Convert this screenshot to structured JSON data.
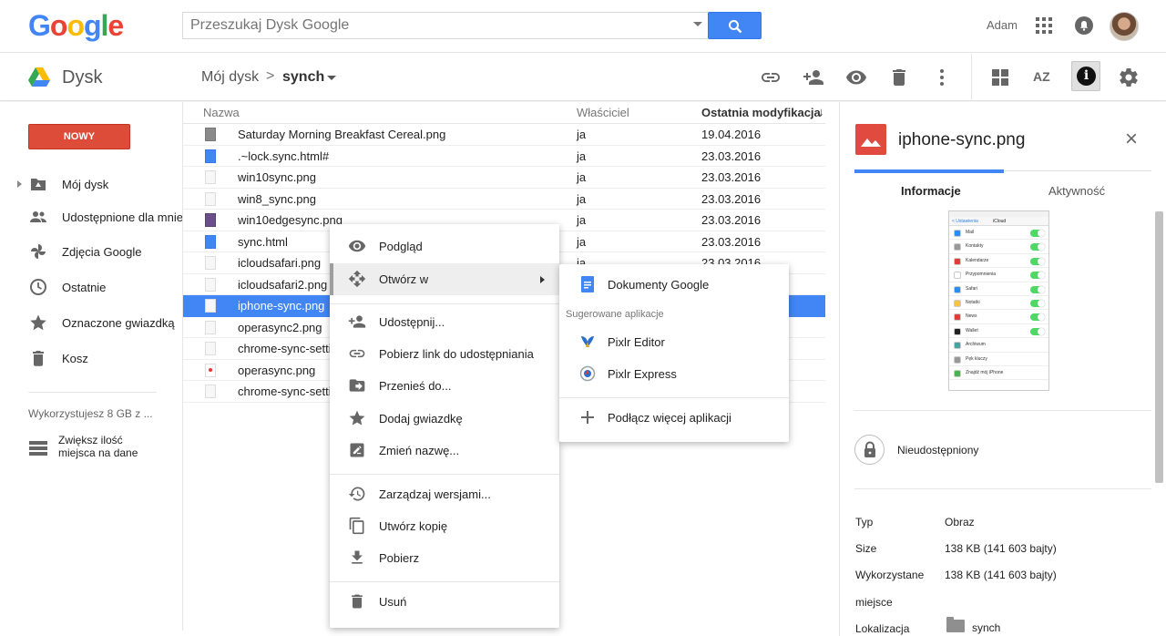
{
  "header": {
    "logo_letters": [
      {
        "ch": "G",
        "color": "#4285f4"
      },
      {
        "ch": "o",
        "color": "#ea4335"
      },
      {
        "ch": "o",
        "color": "#fbbc05"
      },
      {
        "ch": "g",
        "color": "#4285f4"
      },
      {
        "ch": "l",
        "color": "#34a853"
      },
      {
        "ch": "e",
        "color": "#ea4335"
      }
    ],
    "search_placeholder": "Przeszukaj Dysk Google",
    "user_name": "Adam",
    "accent_color": "#4285f4"
  },
  "toolbar": {
    "app_name": "Dysk",
    "breadcrumb_root": "Mój dysk",
    "breadcrumb_separator": ">",
    "breadcrumb_current": "synch",
    "sort_icon_label": "AZ",
    "info_label": "i"
  },
  "sidebar": {
    "new_button": "NOWY",
    "items": [
      {
        "label": "Mój dysk",
        "icon": "drive-folder-icon"
      },
      {
        "label": "Udostępnione dla mnie",
        "icon": "people-icon"
      },
      {
        "label": "Zdjęcia Google",
        "icon": "pinwheel-icon"
      },
      {
        "label": "Ostatnie",
        "icon": "clock-icon"
      },
      {
        "label": "Oznaczone gwiazdką",
        "icon": "star-icon"
      },
      {
        "label": "Kosz",
        "icon": "trash-icon"
      }
    ],
    "storage_text": "Wykorzystujesz 8 GB z ...",
    "upgrade_line1": "Zwiększ ilość",
    "upgrade_line2": "miejsca na dane"
  },
  "file_list": {
    "columns": {
      "name": "Nazwa",
      "owner": "Właściciel",
      "modified": "Ostatnia modyfikacja",
      "sort_arrow": "↓"
    },
    "rows": [
      {
        "name": "Saturday Morning Breakfast Cereal.png",
        "owner": "ja",
        "date": "19.04.2016",
        "icon": "img"
      },
      {
        "name": ".~lock.sync.html#",
        "owner": "ja",
        "date": "23.03.2016",
        "icon": "doc"
      },
      {
        "name": "win10sync.png",
        "owner": "ja",
        "date": "23.03.2016",
        "icon": "plain"
      },
      {
        "name": "win8_sync.png",
        "owner": "ja",
        "date": "23.03.2016",
        "icon": "plain"
      },
      {
        "name": "win10edgesync.png",
        "owner": "ja",
        "date": "23.03.2016",
        "icon": "pur"
      },
      {
        "name": "sync.html",
        "owner": "ja",
        "date": "23.03.2016",
        "icon": "doc"
      },
      {
        "name": "icloudsafari.png",
        "owner": "ja",
        "date": "23.03.2016",
        "icon": "plain"
      },
      {
        "name": "icloudsafari2.png",
        "owner": "ja",
        "date": "",
        "icon": "plain"
      },
      {
        "name": "iphone-sync.png",
        "owner": "",
        "date": "",
        "icon": "plain",
        "selected": true
      },
      {
        "name": "operasync2.png",
        "owner": "",
        "date": "",
        "icon": "plain"
      },
      {
        "name": "chrome-sync-setti",
        "owner": "",
        "date": "",
        "icon": "plain"
      },
      {
        "name": "operasync.png",
        "owner": "",
        "date": "",
        "icon": "red"
      },
      {
        "name": "chrome-sync-setti",
        "owner": "",
        "date": "",
        "icon": "plain"
      }
    ]
  },
  "context_menu": {
    "items": [
      {
        "label": "Podgląd",
        "icon": "eye-icon"
      },
      {
        "label": "Otwórz w",
        "icon": "move-arrows-icon",
        "highlighted": true,
        "submenu": true
      },
      {
        "label": "Udostępnij...",
        "icon": "add-person-icon"
      },
      {
        "label": "Pobierz link do udostępniania",
        "icon": "link-icon"
      },
      {
        "label": "Przenieś do...",
        "icon": "move-folder-icon"
      },
      {
        "label": "Dodaj gwiazdkę",
        "icon": "star-icon"
      },
      {
        "label": "Zmień nazwę...",
        "icon": "rename-icon"
      },
      {
        "label": "Zarządzaj wersjami...",
        "icon": "history-icon"
      },
      {
        "label": "Utwórz kopię",
        "icon": "copy-icon"
      },
      {
        "label": "Pobierz",
        "icon": "download-icon"
      },
      {
        "label": "Usuń",
        "icon": "trash-icon"
      }
    ]
  },
  "open_with_menu": {
    "primary": "Dokumenty Google",
    "caption": "Sugerowane aplikacje",
    "apps": [
      "Pixlr Editor",
      "Pixlr Express"
    ],
    "connect": "Podłącz więcej aplikacji"
  },
  "details": {
    "title": "iphone-sync.png",
    "close": "×",
    "tab_info": "Informacje",
    "tab_activity": "Aktywność",
    "thumbnail": {
      "back": "< Ustawienia",
      "title": "iCloud",
      "rows": [
        {
          "label": "Mail",
          "color": "#2d8cf0",
          "toggle": true
        },
        {
          "label": "Kontakty",
          "color": "#999999",
          "toggle": true
        },
        {
          "label": "Kalendarze",
          "color": "#e33b3b",
          "toggle": true
        },
        {
          "label": "Przypomnienia",
          "color": "#ffffff",
          "toggle": true
        },
        {
          "label": "Safari",
          "color": "#2d8cf0",
          "toggle": true
        },
        {
          "label": "Notatki",
          "color": "#f5c542",
          "toggle": true
        },
        {
          "label": "News",
          "color": "#e33b3b",
          "toggle": true
        },
        {
          "label": "Wallet",
          "color": "#222222",
          "toggle": true
        },
        {
          "label": "Archiwum",
          "color": "#4aa3a3",
          "toggle": false
        },
        {
          "label": "Pęk kluczy",
          "color": "#999999",
          "toggle": false
        },
        {
          "label": "Znajdź mój iPhone",
          "color": "#4caf50",
          "toggle": false
        }
      ]
    },
    "share_status": "Nieudostępniony",
    "properties": [
      {
        "key": "Typ",
        "value": "Obraz"
      },
      {
        "key": "Size",
        "value": "138 KB (141 603 bajty)"
      },
      {
        "key": "Wykorzystane",
        "value": "138 KB (141 603 bajty)"
      },
      {
        "key": "miejsce",
        "value": ""
      },
      {
        "key": "Lokalizacja",
        "value": "synch"
      }
    ]
  }
}
